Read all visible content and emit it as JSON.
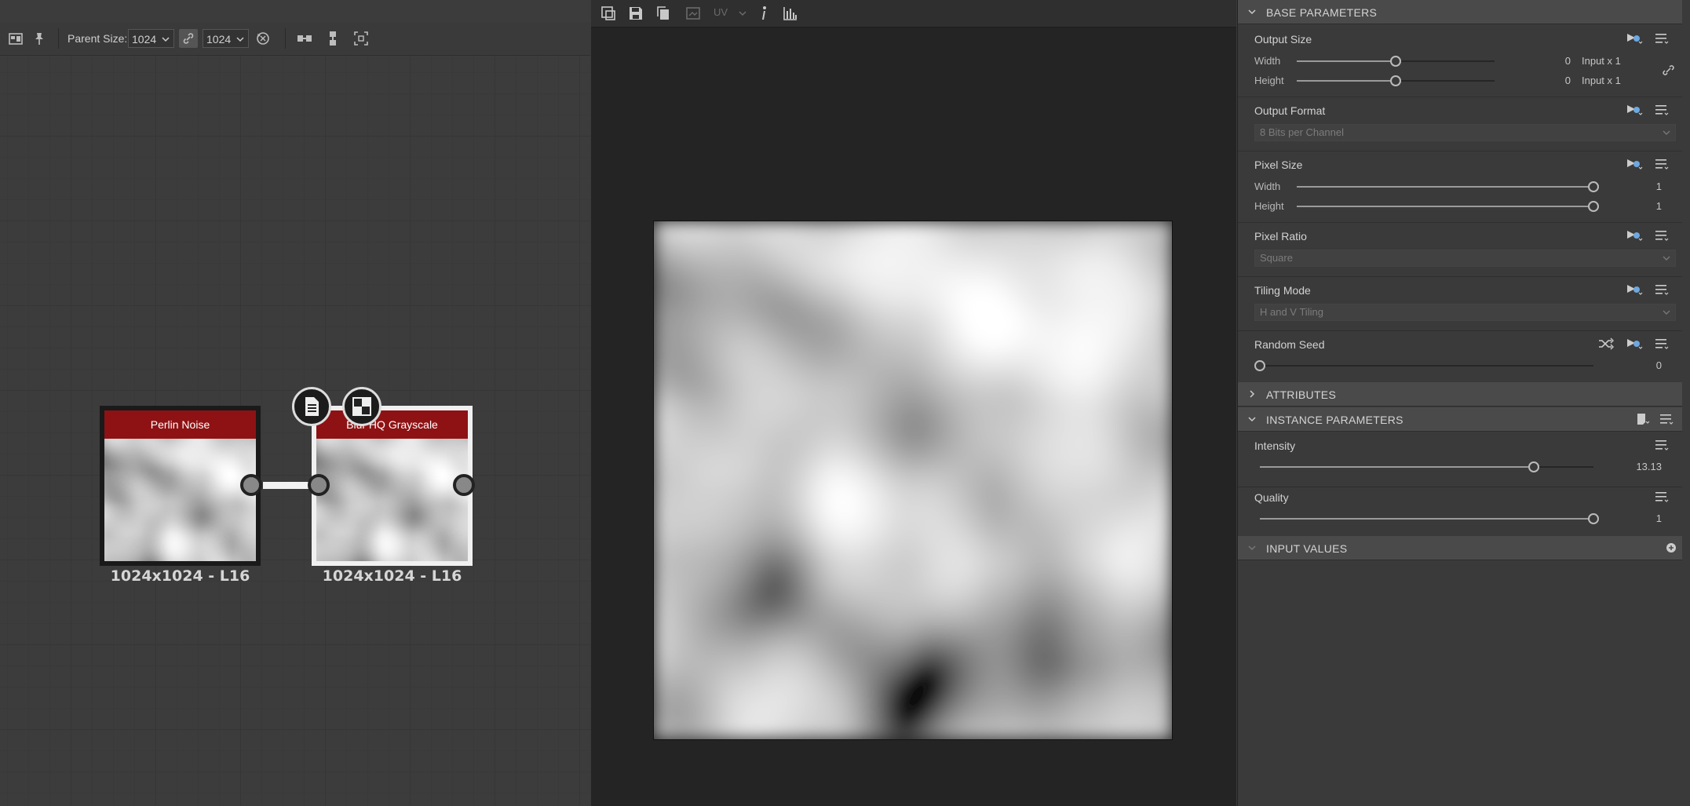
{
  "graph": {
    "toolbar": {
      "parent_size_label": "Parent Size:",
      "width_value": "1024",
      "height_value": "1024"
    },
    "nodes": [
      {
        "title": "Perlin Noise",
        "caption": "1024x1024 - L16"
      },
      {
        "title": "Blur HQ Grayscale",
        "caption": "1024x1024 - L16"
      }
    ]
  },
  "view2d": {
    "toolbar": {
      "uv_label": "UV"
    }
  },
  "properties": {
    "base_parameters": {
      "header": "BASE PARAMETERS",
      "output_size": {
        "title": "Output Size",
        "rows": [
          {
            "label": "Width",
            "value": "0",
            "unit": "Input x 1",
            "level": 0.5
          },
          {
            "label": "Height",
            "value": "0",
            "unit": "Input x 1",
            "level": 0.5
          }
        ]
      },
      "output_format": {
        "title": "Output Format",
        "value": "8 Bits per Channel"
      },
      "pixel_size": {
        "title": "Pixel Size",
        "rows": [
          {
            "label": "Width",
            "value": "1",
            "level": 1.0
          },
          {
            "label": "Height",
            "value": "1",
            "level": 1.0
          }
        ]
      },
      "pixel_ratio": {
        "title": "Pixel Ratio",
        "value": "Square"
      },
      "tiling_mode": {
        "title": "Tiling Mode",
        "value": "H and V Tiling"
      },
      "random_seed": {
        "title": "Random Seed",
        "value": "0",
        "level": 0.0
      }
    },
    "attributes": {
      "header": "ATTRIBUTES"
    },
    "instance_parameters": {
      "header": "INSTANCE PARAMETERS",
      "intensity": {
        "title": "Intensity",
        "value": "13.13",
        "level": 0.82
      },
      "quality": {
        "title": "Quality",
        "value": "1",
        "level": 1.0
      }
    },
    "input_values": {
      "header": "INPUT VALUES"
    }
  },
  "colors": {
    "node_title": "#8e1214",
    "panel_bg": "#3a3a3a",
    "view_bg": "#242424",
    "section_header": "#4a4a4a"
  }
}
